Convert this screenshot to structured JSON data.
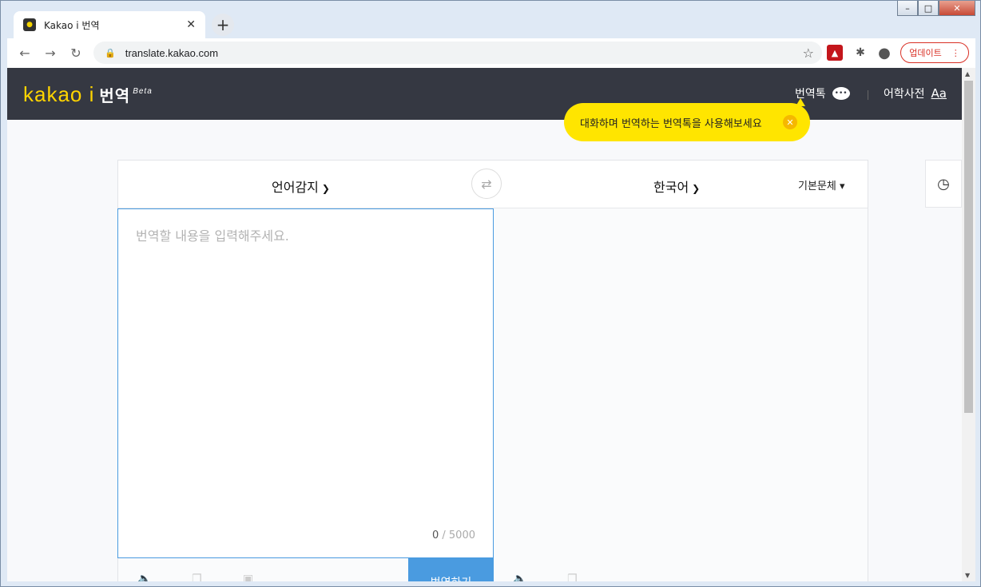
{
  "browser": {
    "tab_title": "Kakao i 번역",
    "url": "translate.kakao.com",
    "update_label": "업데이트"
  },
  "header": {
    "logo_text": "kakao i",
    "logo_kr": "번역",
    "beta": "Beta",
    "talk_label": "번역톡",
    "dict_label": "어학사전",
    "dict_icon_text": "Aa"
  },
  "tooltip": {
    "text": "대화하며 번역하는 번역톡을 사용해보세요"
  },
  "translator": {
    "source_lang": "언어감지",
    "target_lang": "한국어",
    "style_label": "기본문체",
    "placeholder": "번역할 내용을 입력해주세요.",
    "count_current": "0",
    "count_max": "/ 5000",
    "translate_button": "번역하기"
  },
  "colors": {
    "header_bg": "#353842",
    "accent_yellow": "#ffe500",
    "logo_yellow": "#ffd400",
    "accent_blue": "#4a9be0"
  }
}
